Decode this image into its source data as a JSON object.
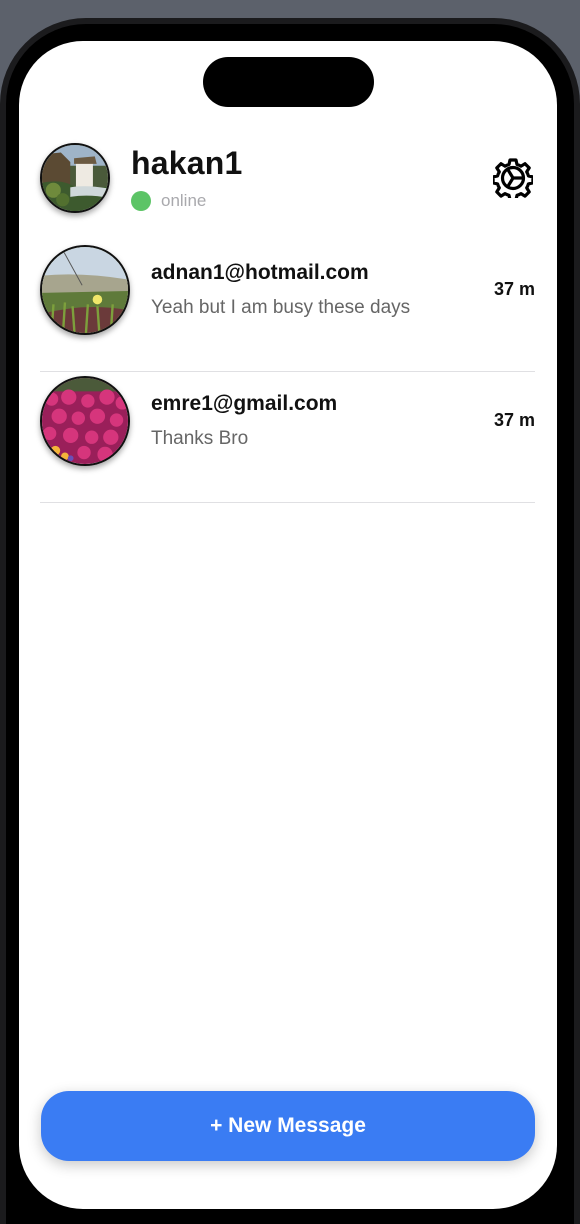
{
  "header": {
    "username": "hakan1",
    "status": "online",
    "status_color": "#5cc466",
    "avatar_icon": "waterfall-photo",
    "settings_icon": "gear-icon"
  },
  "conversations": [
    {
      "name": "adnan1@hotmail.com",
      "preview": "Yeah but I am busy these days",
      "time": "37 m",
      "avatar_icon": "meadow-photo"
    },
    {
      "name": "emre1@gmail.com",
      "preview": "Thanks Bro",
      "time": "37 m",
      "avatar_icon": "flowers-photo"
    }
  ],
  "new_message_button": {
    "label": "+ New Message",
    "color": "#3a7cf3"
  }
}
